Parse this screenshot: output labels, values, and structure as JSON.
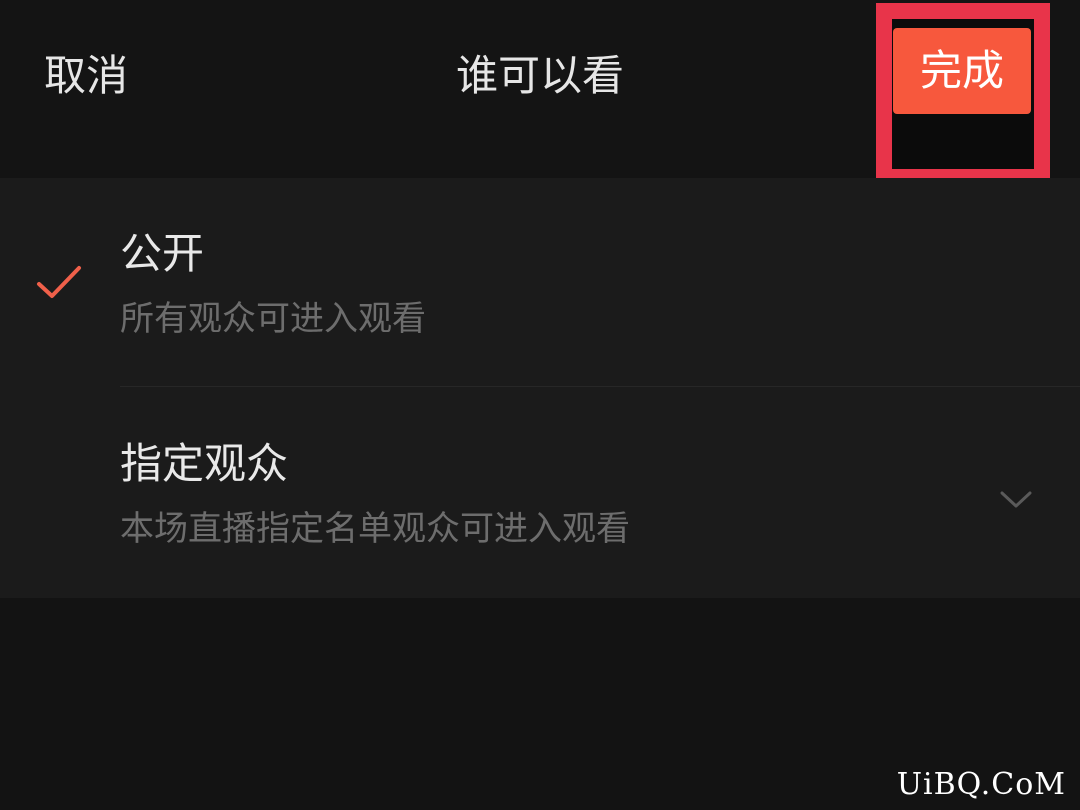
{
  "header": {
    "cancel_label": "取消",
    "title": "谁可以看",
    "done_label": "完成"
  },
  "options": [
    {
      "title": "公开",
      "subtitle": "所有观众可进入观看",
      "selected": true,
      "icon": "check-icon"
    },
    {
      "title": "指定观众",
      "subtitle": "本场直播指定名单观众可进入观看",
      "selected": false,
      "icon": "chevron-down-icon"
    }
  ],
  "watermark": "UiBQ.CoM",
  "colors": {
    "accent": "#f7583d",
    "highlight_border": "#e8344a",
    "background": "#131313"
  }
}
